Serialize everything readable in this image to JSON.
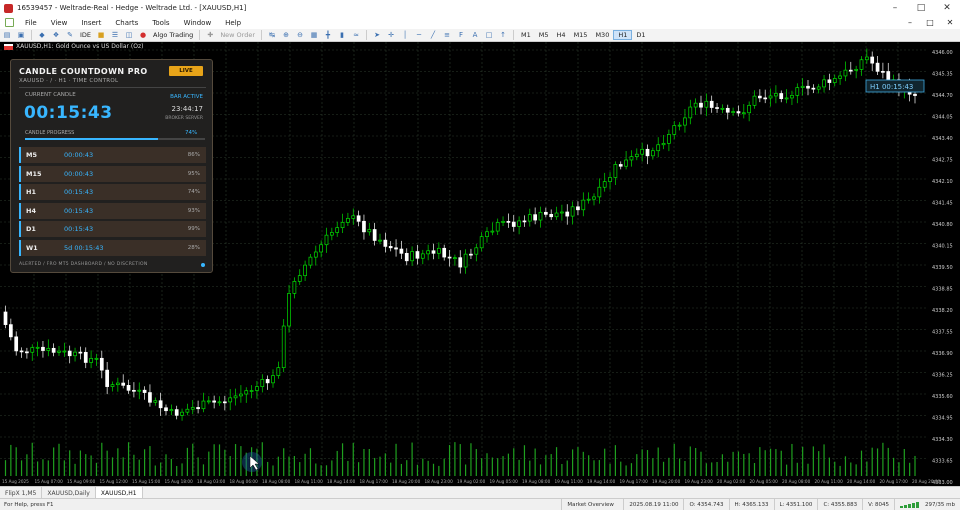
{
  "window": {
    "title": "16539457 - Weltrade-Real - Hedge - Weltrade Ltd. - [XAUUSD,H1]",
    "controls": {
      "minimize": "–",
      "maximize": "□",
      "close": "✕"
    }
  },
  "menu": {
    "items": [
      "File",
      "View",
      "Insert",
      "Charts",
      "Tools",
      "Window",
      "Help"
    ],
    "right_controls": [
      "–",
      "□",
      "✕"
    ]
  },
  "toolbar": {
    "ide_label": "IDE",
    "algo_trading_label": "Algo Trading",
    "new_order_label": "New Order",
    "timeframes": [
      "M1",
      "M5",
      "M15",
      "M30",
      "H1",
      "H4",
      "D1"
    ],
    "timeframe_display": [
      "M1",
      "M5",
      "H4",
      "M15",
      "M30",
      "H1",
      "D1"
    ],
    "active_timeframe": "H1"
  },
  "chart": {
    "symbol_header": "XAUUSD,H1: Gold Ounce vs US Dollar (Oz)",
    "price_label": "H1 00:15:43",
    "colors": {
      "up": "#00e000",
      "down": "#ffffff",
      "grid": "#2c3a2c",
      "volume": "#1fa01f"
    }
  },
  "panel": {
    "title": "CANDLE COUNTDOWN PRO",
    "subtitle": "XAUUSD · / · H1 · TIME CONTROL",
    "live_badge": "LIVE",
    "current_label": "CURRENT CANDLE",
    "current_timer": "00:15:43",
    "bar_status": "BAR ACTIVE",
    "server_time": "23:44:17",
    "server_label": "BROKER SERVER",
    "progress_label": "CANDLE PROGRESS",
    "progress_pct_text": "74%",
    "progress_value": 0.74,
    "rows": [
      {
        "tf": "M5",
        "time": "00:00:43",
        "pct": "86%"
      },
      {
        "tf": "M15",
        "time": "00:00:43",
        "pct": "95%"
      },
      {
        "tf": "H1",
        "time": "00:15:43",
        "pct": "74%"
      },
      {
        "tf": "H4",
        "time": "00:15:43",
        "pct": "93%"
      },
      {
        "tf": "D1",
        "time": "00:15:43",
        "pct": "99%"
      },
      {
        "tf": "W1",
        "time": "5d 00:15:43",
        "pct": "28%"
      }
    ],
    "footer": "ALERTED / FRO MT5 DASHBOARD / NO DISCRETION"
  },
  "tabs": [
    "FlipX 1,M5",
    "XAUUSD,Daily",
    "XAUUSD,H1"
  ],
  "active_tab": "XAUUSD,H1",
  "status": {
    "help": "For Help, press F1",
    "profile": "Market Overview",
    "datetime": "2025.08.19 11:00",
    "open": "O: 4354.743",
    "high": "H: 4365.133",
    "low": "L: 4351.100",
    "close": "C: 4355.883",
    "volume": "V: 8045",
    "traffic": "297/35 mb"
  }
}
